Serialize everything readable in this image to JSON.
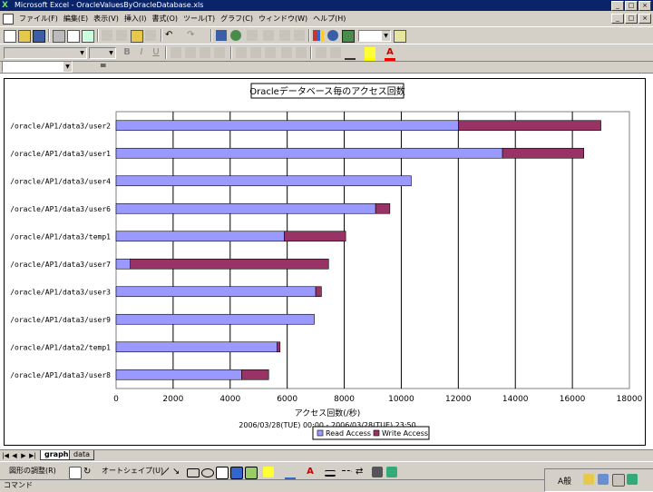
{
  "window": {
    "title": "Microsoft Excel - OracleValuesByOracleDatabase.xls",
    "icon": "excel-app-icon",
    "buttons": [
      "_",
      "□",
      "×"
    ]
  },
  "menu": {
    "items": [
      "ファイル(F)",
      "編集(E)",
      "表示(V)",
      "挿入(I)",
      "書式(O)",
      "ツール(T)",
      "グラフ(C)",
      "ウィンドウ(W)",
      "ヘルプ(H)"
    ],
    "doc_buttons": [
      "_",
      "□",
      "×"
    ]
  },
  "toolbar": {
    "zoom_value": ""
  },
  "formula": {
    "name_box": "",
    "equals": "="
  },
  "chart_data": {
    "type": "bar",
    "orientation": "horizontal",
    "stacked": true,
    "title": "Oracleデータベース毎のアクセス回数",
    "xlabel": "アクセス回数(/秒)",
    "subtitle": "2006/03/28(TUE) 00:00 - 2006/03/28(TUE) 23:50",
    "xlim": [
      0,
      18000
    ],
    "xticks": [
      "0",
      "2000",
      "4000",
      "6000",
      "8000",
      "10000",
      "12000",
      "14000",
      "16000",
      "18000"
    ],
    "grid": true,
    "legend_position": "bottom",
    "categories": [
      "/oracle/AP1/data3/user2",
      "/oracle/AP1/data3/user1",
      "/oracle/AP1/data3/user4",
      "/oracle/AP1/data3/user6",
      "/oracle/AP1/data3/temp1",
      "/oracle/AP1/data3/user7",
      "/oracle/AP1/data3/user3",
      "/oracle/AP1/data3/user9",
      "/oracle/AP1/data2/temp1",
      "/oracle/AP1/data3/user8"
    ],
    "series": [
      {
        "name": "Read Access",
        "color": "#9999ff",
        "values": [
          12000,
          13550,
          10350,
          9100,
          5900,
          500,
          7000,
          6950,
          5650,
          4400
        ]
      },
      {
        "name": "Write Access",
        "color": "#993366",
        "values": [
          5000,
          2850,
          0,
          500,
          2150,
          6950,
          200,
          0,
          100,
          950
        ]
      }
    ]
  },
  "sheet_tabs": {
    "nav": [
      "|◀",
      "◀",
      "▶",
      "▶|"
    ],
    "tabs": [
      "graph",
      "data"
    ],
    "active": "graph"
  },
  "drawing_toolbar": {
    "draw_menu": "図形の調整(R)",
    "autoshapes": "オートシェイプ(U)"
  },
  "status": {
    "text": "コマンド"
  },
  "tray": {
    "label": "A般"
  }
}
